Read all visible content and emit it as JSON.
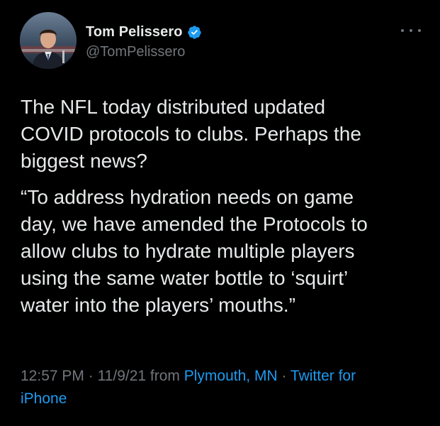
{
  "author": {
    "name": "Tom Pelissero",
    "handle": "@TomPelissero",
    "verified": true,
    "verified_color": "#1d9bf0"
  },
  "menu": {
    "icon": "more-horizontal-icon"
  },
  "tweet": {
    "paragraphs": [
      "The NFL today distributed updated\nCOVID protocols to clubs. Perhaps the\nbiggest news?",
      "“To address hydration needs on game\nday, we have amended the Protocols to\nallow clubs to hydrate multiple players\nusing the same water bottle to ‘squirt’\nwater into the players’ mouths.”"
    ]
  },
  "meta": {
    "time": "12:57 PM",
    "sep1": " · ",
    "date": "11/9/21",
    "from": " from ",
    "location": "Plymouth, MN",
    "sep2": " · ",
    "source_line1": "Twitter for",
    "source_line2": "iPhone"
  },
  "colors": {
    "background": "#000000",
    "text": "#e7e9ea",
    "secondary": "#71767b",
    "link": "#1d9bf0"
  }
}
